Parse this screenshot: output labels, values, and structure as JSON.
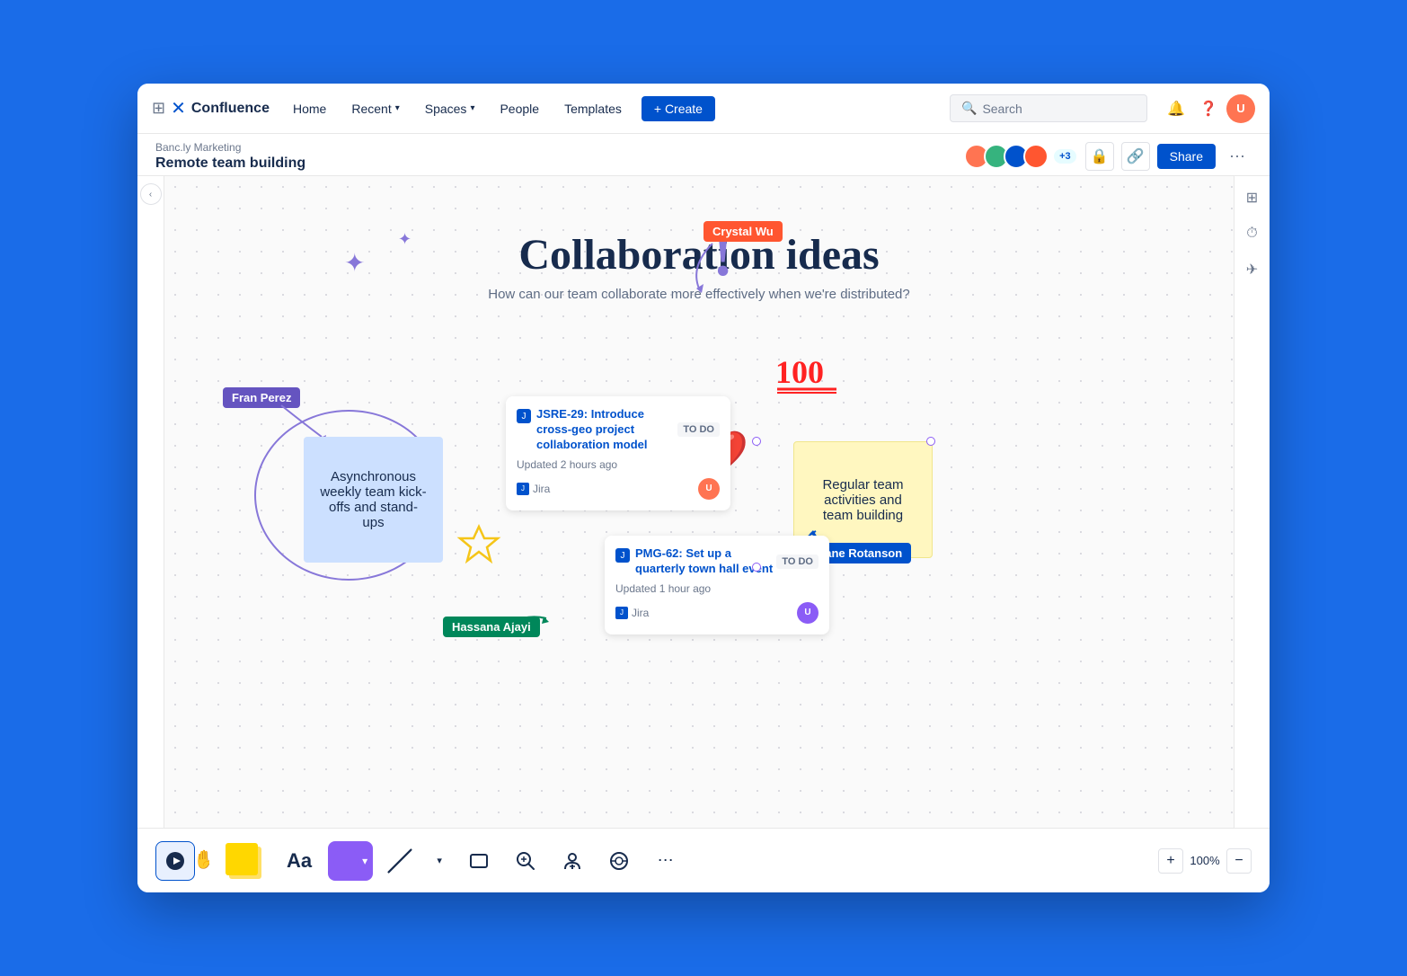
{
  "app": {
    "name": "Confluence",
    "logo_symbol": "✕"
  },
  "nav": {
    "home": "Home",
    "recent": "Recent",
    "spaces": "Spaces",
    "people": "People",
    "templates": "Templates",
    "create": "+ Create",
    "search_placeholder": "Search"
  },
  "breadcrumb": {
    "parent": "Banc.ly Marketing",
    "current": "Remote team building"
  },
  "header_actions": {
    "share": "Share",
    "collaborator_count": "+3"
  },
  "canvas": {
    "title": "Collaboration ideas",
    "subtitle": "How can our team collaborate more effectively when we're distributed?",
    "sticky_note_1": "Asynchronous weekly team kick-offs and stand-ups",
    "sticky_note_2": "Regular team activities and team building",
    "jira_card_1": {
      "id": "JSRE-29",
      "title": "Introduce cross-geo project collaboration model",
      "status": "TO DO",
      "updated": "Updated 2 hours ago",
      "source": "Jira"
    },
    "jira_card_2": {
      "id": "PMG-62",
      "title": "Set up a quarterly town hall event",
      "status": "TO DO",
      "updated": "Updated 1 hour ago",
      "source": "Jira"
    },
    "name_tags": {
      "crystal": "Crystal Wu",
      "fran": "Fran Perez",
      "hassana": "Hassana Ajayi",
      "jane": "Jane Rotanson"
    }
  },
  "bottom_toolbar": {
    "text_tool": "Aa",
    "zoom_level": "100%",
    "zoom_in": "+",
    "zoom_out": "−"
  },
  "zoom": {
    "level": "100%",
    "plus": "+",
    "minus": "−"
  }
}
